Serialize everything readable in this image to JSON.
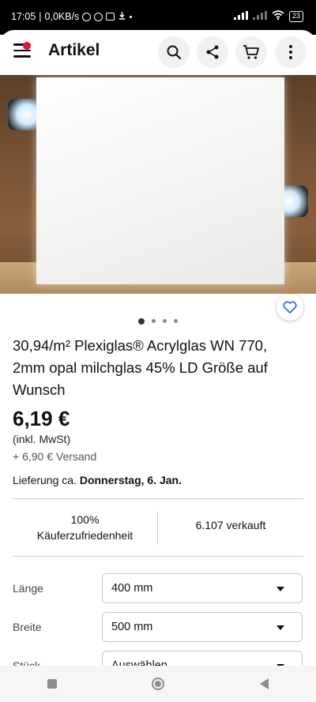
{
  "status_bar": {
    "time": "17:05",
    "speed": "0,0KB/s",
    "battery": "23"
  },
  "app_bar": {
    "title": "Artikel",
    "icons": [
      "menu-icon",
      "search-icon",
      "share-icon",
      "cart-icon",
      "more-icon"
    ]
  },
  "gallery": {
    "image_count": 4,
    "active_index": 0
  },
  "item": {
    "title": "30,94/m² Plexiglas® Acrylglas WN 770, 2mm opal milchglas 45% LD Größe auf Wunsch",
    "price": "6,19 €",
    "vat_note": "(inkl. MwSt)",
    "shipping": "+ 6,90 € Versand",
    "delivery_prefix": "Lieferung ca. ",
    "delivery_date": "Donnerstag, 6. Jan."
  },
  "stats": {
    "feedback_percent": "100%",
    "feedback_label": "Käuferzufriedenheit",
    "sold": "6.107 verkauft"
  },
  "variations": [
    {
      "label": "Länge",
      "value": "400 mm"
    },
    {
      "label": "Breite",
      "value": "500 mm"
    },
    {
      "label": "Stück",
      "value": "Auswählen"
    }
  ],
  "colors": {
    "accent_red": "#e0153e",
    "favorite_blue": "#3665f3"
  }
}
